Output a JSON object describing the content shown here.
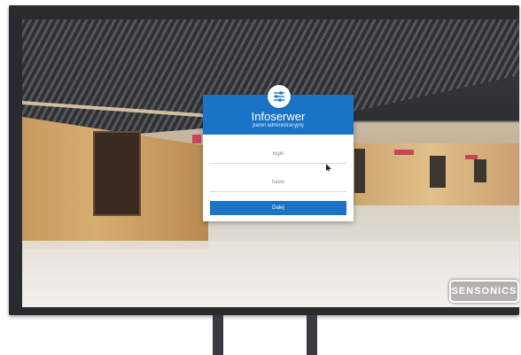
{
  "login_card": {
    "title": "Infoserwer",
    "subtitle": "panel administracyjny",
    "login_placeholder": "login",
    "password_placeholder": "hasło",
    "submit_label": "Dalej"
  },
  "brand": {
    "label": "SENSONICS"
  },
  "icons": {
    "logo": "sliders-icon",
    "cursor": "pointer-cursor-icon"
  },
  "colors": {
    "primary": "#1a73c6",
    "card_bg": "#ffffff",
    "frame": "#2a2b2e"
  }
}
